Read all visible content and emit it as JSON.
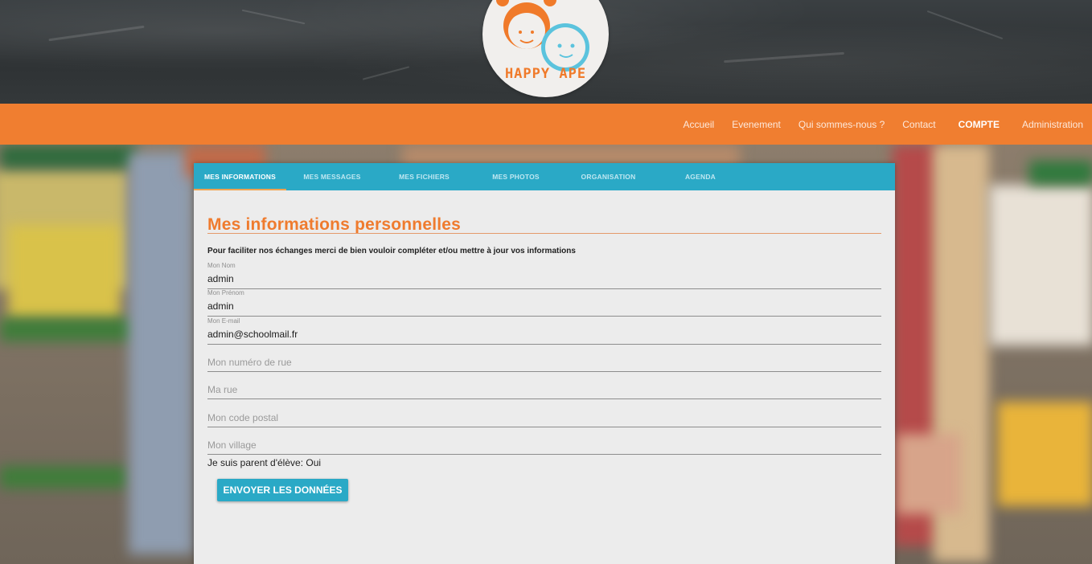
{
  "logo": {
    "text": "HAPPY APE"
  },
  "nav": {
    "items": [
      {
        "label": "Accueil"
      },
      {
        "label": "Evenement"
      },
      {
        "label": "Qui sommes-nous ?"
      },
      {
        "label": "Contact"
      },
      {
        "label": "COMPTE"
      },
      {
        "label": "Administration"
      }
    ]
  },
  "tabs": [
    {
      "label": "MES INFORMATIONS"
    },
    {
      "label": "MES MESSAGES"
    },
    {
      "label": "MES FICHIERS"
    },
    {
      "label": "MES PHOTOS"
    },
    {
      "label": "ORGANISATION"
    },
    {
      "label": "AGENDA"
    }
  ],
  "main": {
    "title": "Mes informations personnelles",
    "intro": "Pour faciliter nos échanges merci de bien vouloir compléter et/ou mettre à jour vos informations"
  },
  "fields": {
    "nom": {
      "label": "Mon Nom",
      "value": "admin"
    },
    "prenom": {
      "label": "Mon Prénom",
      "value": "admin"
    },
    "email": {
      "label": "Mon E-mail",
      "value": "admin@schoolmail.fr"
    },
    "rue_num": {
      "placeholder": "Mon numéro de rue"
    },
    "rue": {
      "placeholder": "Ma rue"
    },
    "code_postal": {
      "placeholder": "Mon code postal"
    },
    "village": {
      "placeholder": "Mon village"
    }
  },
  "parent_status": "Je suis parent d'élève: Oui",
  "submit_label": "ENVOYER LES DONNÉES",
  "colors": {
    "accent_orange": "#f07e30",
    "accent_blue": "#2aa9c6",
    "title_orange": "#ef7b2e"
  }
}
